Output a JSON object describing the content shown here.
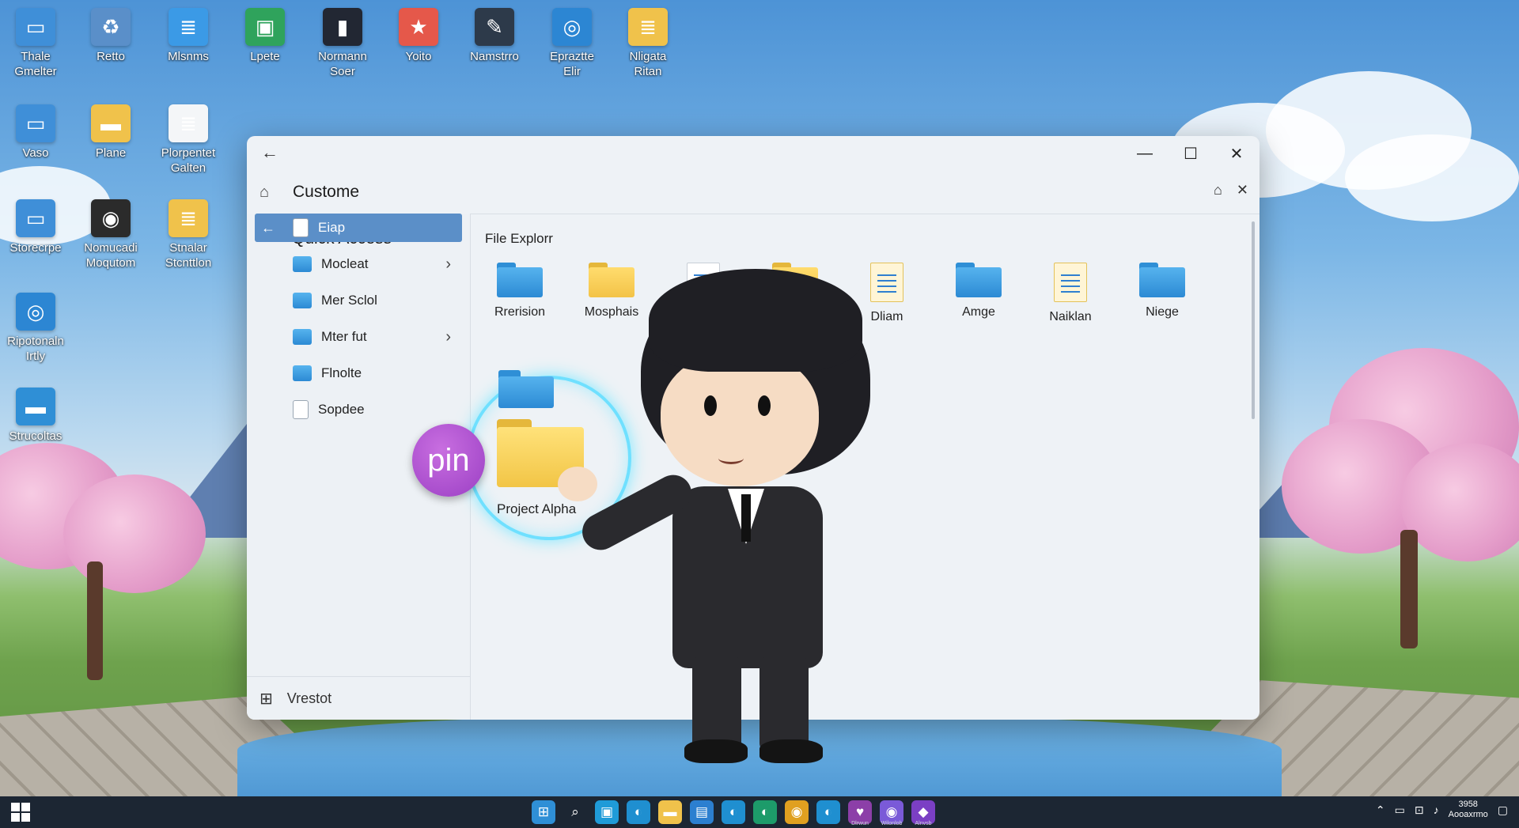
{
  "desktop": {
    "icons": [
      {
        "label": "Thale\nGmelter",
        "color": "#3f8fd8",
        "icon": "computer-icon"
      },
      {
        "label": "Retto",
        "color": "#5a8fc9",
        "icon": "recycle-bin-icon"
      },
      {
        "label": "Mlsnms",
        "color": "#3b9ae6",
        "icon": "document-icon"
      },
      {
        "label": "Lpete",
        "color": "#2fa35c",
        "icon": "monitor-icon"
      },
      {
        "label": "Normann\nSoer",
        "color": "#222733",
        "icon": "signal-chart-icon"
      },
      {
        "label": "Yoito",
        "color": "#e5584a",
        "icon": "star-badge-icon"
      },
      {
        "label": "Namstrro",
        "color": "#2d3a4a",
        "icon": "pen-tool-icon"
      },
      {
        "label": "Epraztte\nElir",
        "color": "#2c86d3",
        "icon": "globe-app-icon"
      },
      {
        "label": "Nligata\nRitan",
        "color": "#f0c24b",
        "icon": "notes-icon"
      },
      {
        "label": "Vaso",
        "color": "#3f8fd8",
        "icon": "computer-icon"
      },
      {
        "label": "Plane",
        "color": "#f0c24b",
        "icon": "folder-icon"
      },
      {
        "label": "Plorpentet\nGalten",
        "color": "#f4f6f8",
        "icon": "document-icon"
      },
      {
        "label": "Storecrpe",
        "color": "#3f8fd8",
        "icon": "computer-icon"
      },
      {
        "label": "Nomucadi\nMoqutom",
        "color": "#2b2b2b",
        "icon": "media-player-icon"
      },
      {
        "label": "Stnalar\nStcnttlon",
        "color": "#f0c24b",
        "icon": "notes-icon"
      },
      {
        "label": "Ripotonaln\nIrtly",
        "color": "#2c86d3",
        "icon": "globe-app-icon"
      },
      {
        "label": "Strucoltas",
        "color": "#2f8fd6",
        "icon": "folder-icon"
      }
    ]
  },
  "window": {
    "title": "Custome",
    "back_symbol": "←",
    "controls": {
      "minimize": "—",
      "maximize": "☐",
      "close": "✕"
    },
    "sidebar": {
      "heading": "Quick Access",
      "items": [
        {
          "label": "Eiap",
          "selected": true,
          "icon": "document-icon",
          "arrow": "←",
          "chevron": ""
        },
        {
          "label": "Mocleat",
          "selected": false,
          "icon": "folder-icon",
          "arrow": "",
          "chevron": "›"
        },
        {
          "label": "Mer Sclol",
          "selected": false,
          "icon": "folder-icon",
          "arrow": "",
          "chevron": ""
        },
        {
          "label": "Mter fut",
          "selected": false,
          "icon": "folder-icon",
          "arrow": "",
          "chevron": "›"
        },
        {
          "label": "Flnolte",
          "selected": false,
          "icon": "folder-icon",
          "arrow": "",
          "chevron": ""
        },
        {
          "label": "Sopdee",
          "selected": false,
          "icon": "document-icon",
          "arrow": "",
          "chevron": ""
        }
      ],
      "footer_label": "Vrestot"
    },
    "content": {
      "section_title": "File Explorr",
      "items": [
        {
          "label": "Rrerision",
          "type": "folder-blue"
        },
        {
          "label": "Mosphais",
          "type": "folder-yellow"
        },
        {
          "label": "",
          "type": "document"
        },
        {
          "label": "",
          "type": "folder-yellow"
        },
        {
          "label": "Dliam",
          "type": "document-yellow"
        },
        {
          "label": "Amge",
          "type": "folder-blue"
        },
        {
          "label": "Naiklan",
          "type": "document-yellow"
        },
        {
          "label": "Niege",
          "type": "folder-blue"
        }
      ],
      "drag": {
        "badge": "pin",
        "folder_label": "Project Alpha"
      }
    }
  },
  "taskbar": {
    "apps": [
      {
        "icon": "windows-grid-icon",
        "color": "#2f8fd6",
        "label": ""
      },
      {
        "icon": "search-icon",
        "color": "transparent",
        "label": ""
      },
      {
        "icon": "widgets-icon",
        "color": "#1f9bd8",
        "label": ""
      },
      {
        "icon": "edge-icon",
        "color": "#1f8fd0",
        "label": ""
      },
      {
        "icon": "file-explorer-icon",
        "color": "#f0c24b",
        "label": ""
      },
      {
        "icon": "store-icon",
        "color": "#2c7fd0",
        "label": ""
      },
      {
        "icon": "edge-icon",
        "color": "#1f8fd0",
        "label": ""
      },
      {
        "icon": "edge-icon",
        "color": "#1d9b6a",
        "label": ""
      },
      {
        "icon": "chrome-icon",
        "color": "#e0a020",
        "label": ""
      },
      {
        "icon": "edge-icon",
        "color": "#1f8fd0",
        "label": ""
      },
      {
        "icon": "heart-app-icon",
        "color": "#8c3fa8",
        "label": "Dlrwun"
      },
      {
        "icon": "chrome-icon",
        "color": "#7a5ad8",
        "label": "Wilonlob"
      },
      {
        "icon": "vs-icon",
        "color": "#7b3fc4",
        "label": "Alnvsb"
      }
    ],
    "tray": {
      "clock_time": "3958",
      "clock_date": "Aooaxrmo"
    }
  }
}
